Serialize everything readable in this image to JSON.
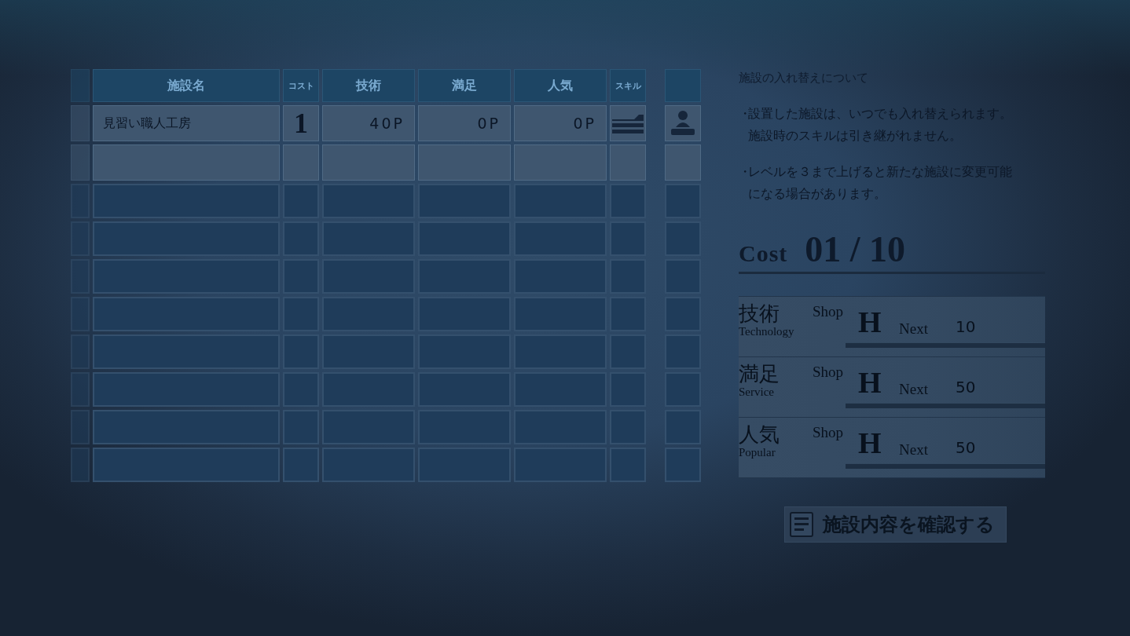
{
  "table": {
    "columns": [
      {
        "label": "施設名"
      },
      {
        "label": "コスト"
      },
      {
        "label": "技術"
      },
      {
        "label": "満足"
      },
      {
        "label": "人気"
      },
      {
        "label": "スキル"
      }
    ],
    "rows": [
      {
        "kind": "facility",
        "name": "見習い職人工房",
        "cost": "1",
        "technology": "40P",
        "service": "0P",
        "popularity": "0P"
      },
      {
        "kind": "open"
      },
      {
        "kind": "locked"
      },
      {
        "kind": "locked"
      },
      {
        "kind": "locked"
      },
      {
        "kind": "locked"
      },
      {
        "kind": "locked"
      },
      {
        "kind": "locked"
      },
      {
        "kind": "locked"
      },
      {
        "kind": "locked"
      }
    ]
  },
  "info": {
    "heading": "施設の入れ替えについて",
    "bullets": [
      {
        "marker": "・",
        "text": "設置した施設は、いつでも入れ替えられます。施設時のスキルは引き継がれません。"
      },
      {
        "marker": "・",
        "text": "レベルを３まで上げると新たな施設に変更可能になる場合があります。"
      }
    ]
  },
  "cost": {
    "label": "Cost",
    "value": "01 / 10"
  },
  "stats": [
    {
      "label": "技術",
      "sublabel": "Technology",
      "shop": "Shop",
      "rank": "H",
      "next_label": "Next",
      "next_value": "10"
    },
    {
      "label": "満足",
      "sublabel": "Service",
      "shop": "Shop",
      "rank": "H",
      "next_label": "Next",
      "next_value": "50"
    },
    {
      "label": "人気",
      "sublabel": "Popular",
      "shop": "Shop",
      "rank": "H",
      "next_label": "Next",
      "next_value": "50"
    }
  ],
  "confirm_button": {
    "label": "施設内容を確認する"
  }
}
